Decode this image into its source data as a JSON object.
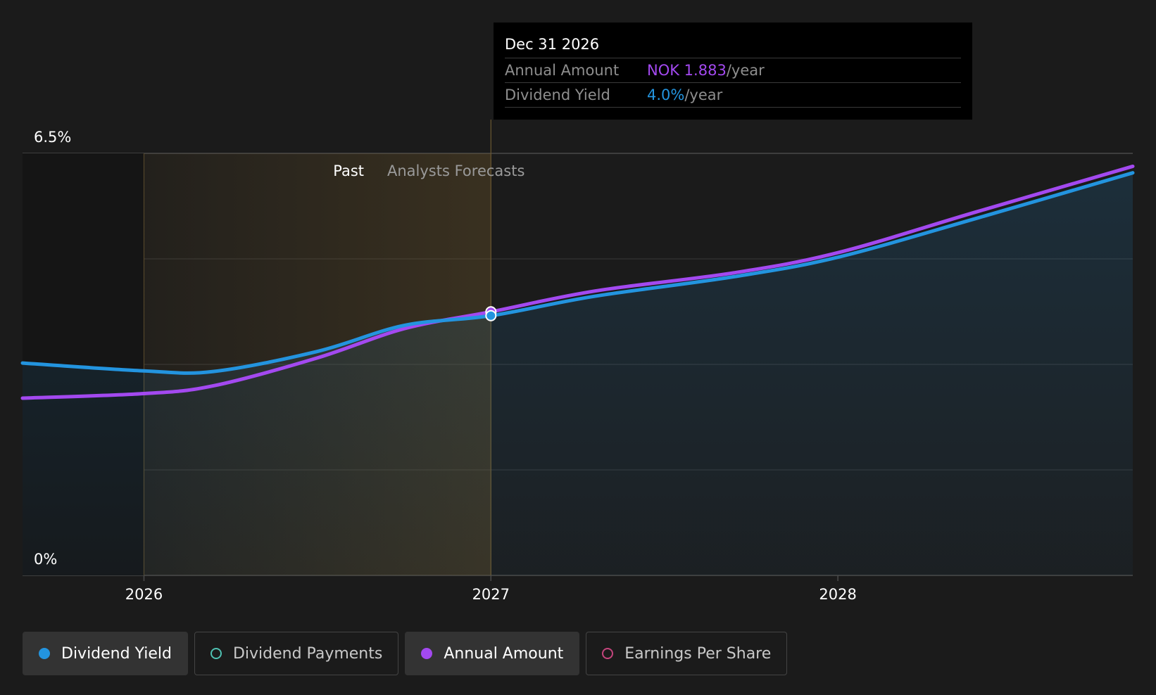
{
  "chart_data": {
    "type": "line",
    "y_axis": {
      "top_label": "6.5%",
      "bottom_label": "0%",
      "ylim": [
        0,
        6.5
      ]
    },
    "x_axis": {
      "range": [
        2025.65,
        2028.85
      ],
      "ticks": [
        {
          "label": "2026",
          "value": 2026
        },
        {
          "label": "2027",
          "value": 2027
        },
        {
          "label": "2028",
          "value": 2028
        }
      ]
    },
    "regions": {
      "past_label": "Past",
      "forecast_label": "Analysts Forecasts",
      "highlight_start": 2026,
      "divider": 2027
    },
    "series": [
      {
        "name": "Dividend Yield",
        "color": "#2394df",
        "points": [
          [
            2025.65,
            3.27
          ],
          [
            2026.0,
            3.15
          ],
          [
            2026.2,
            3.14
          ],
          [
            2026.5,
            3.45
          ],
          [
            2026.75,
            3.85
          ],
          [
            2027.0,
            4.0
          ],
          [
            2027.3,
            4.3
          ],
          [
            2027.7,
            4.6
          ],
          [
            2028.0,
            4.9
          ],
          [
            2028.4,
            5.5
          ],
          [
            2028.85,
            6.2
          ]
        ]
      },
      {
        "name": "Annual Amount",
        "color": "#a349f0",
        "points": [
          [
            2025.65,
            2.73
          ],
          [
            2026.0,
            2.8
          ],
          [
            2026.2,
            2.92
          ],
          [
            2026.5,
            3.35
          ],
          [
            2026.75,
            3.8
          ],
          [
            2027.0,
            4.06
          ],
          [
            2027.3,
            4.38
          ],
          [
            2027.7,
            4.66
          ],
          [
            2028.0,
            4.97
          ],
          [
            2028.4,
            5.6
          ],
          [
            2028.85,
            6.3
          ]
        ]
      }
    ],
    "tooltip": {
      "date": "Dec 31 2026",
      "x": 2027.0,
      "rows": [
        {
          "label": "Annual Amount",
          "value": "NOK 1.883",
          "unit": "/year",
          "color": "#a349f0"
        },
        {
          "label": "Dividend Yield",
          "value": "4.0%",
          "unit": "/year",
          "color": "#2394df"
        }
      ]
    },
    "legend": [
      {
        "label": "Dividend Yield",
        "color": "#2394df",
        "filled": true,
        "active": true
      },
      {
        "label": "Dividend Payments",
        "color": "#4fc1b2",
        "filled": false,
        "active": false
      },
      {
        "label": "Annual Amount",
        "color": "#a349f0",
        "filled": true,
        "active": true
      },
      {
        "label": "Earnings Per Share",
        "color": "#c5457d",
        "filled": false,
        "active": false
      }
    ]
  }
}
